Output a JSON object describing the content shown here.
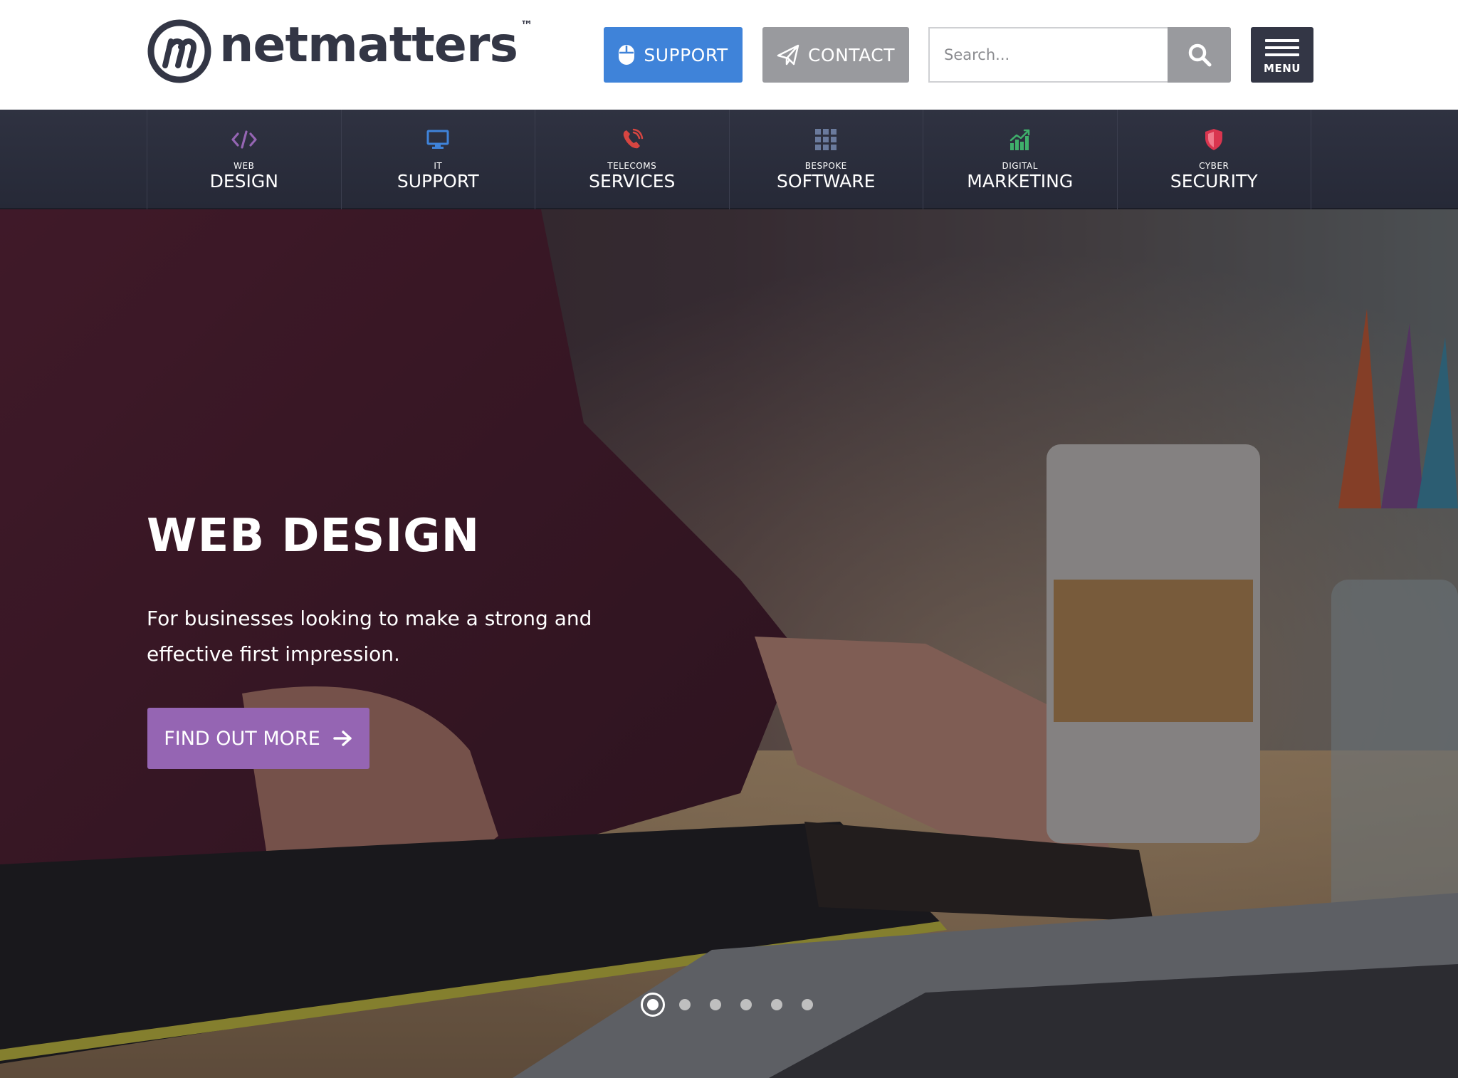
{
  "brand": {
    "name": "netmatters",
    "trademark": "™"
  },
  "header": {
    "support_label": "SUPPORT",
    "contact_label": "CONTACT",
    "search_placeholder": "Search...",
    "menu_label": "MENU"
  },
  "services": [
    {
      "small": "WEB",
      "big": "DESIGN",
      "icon": "code-icon",
      "color": "#9565b3"
    },
    {
      "small": "IT",
      "big": "SUPPORT",
      "icon": "monitor-icon",
      "color": "#3f83d9"
    },
    {
      "small": "TELECOMS",
      "big": "SERVICES",
      "icon": "phone-icon",
      "color": "#d64541"
    },
    {
      "small": "BESPOKE",
      "big": "SOFTWARE",
      "icon": "grid-icon",
      "color": "#6a7a9c"
    },
    {
      "small": "DIGITAL",
      "big": "MARKETING",
      "icon": "chart-icon",
      "color": "#3fb06b"
    },
    {
      "small": "CYBER",
      "big": "SECURITY",
      "icon": "shield-icon",
      "color": "#d9354f"
    }
  ],
  "hero": {
    "title": "WEB DESIGN",
    "text": "For businesses looking to make a strong and effective first impression.",
    "cta_label": "FIND OUT MORE",
    "slides_total": 6,
    "active_slide": 1
  },
  "colors": {
    "support_blue": "#3f83d9",
    "contact_grey": "#999a9e",
    "nav_dark": "#2f3241",
    "cta_purple": "#9565b3"
  }
}
